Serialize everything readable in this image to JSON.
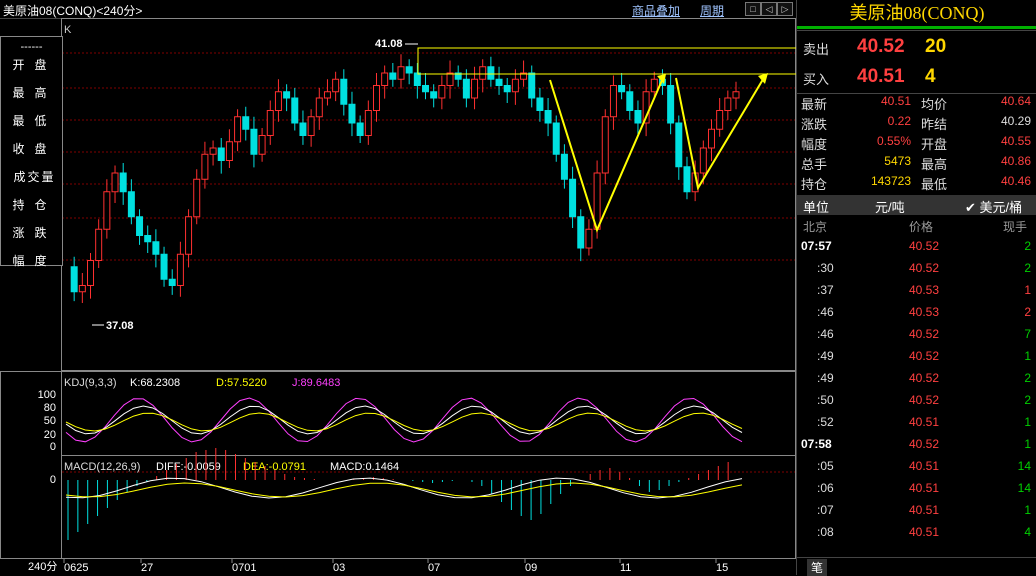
{
  "topbar": {
    "title": "美原油08(CONQ)<240分>",
    "overlay_link": "商品叠加",
    "period_link": "周期",
    "buttons": [
      "□",
      "◁",
      "▷",
      "✕"
    ]
  },
  "left_labels": [
    "开盘",
    "最高",
    "最低",
    "收盘",
    "成交量",
    "持仓",
    "涨跌",
    "幅度"
  ],
  "left_dash": "------",
  "k_label": "K",
  "price_annotations": {
    "high": "41.08",
    "low": "37.08"
  },
  "kdj": {
    "label": "KDJ(9,3,3)",
    "k": "K:68.2308",
    "d": "D:57.5220",
    "j": "J:89.6483",
    "scale": [
      "100",
      "80",
      "50",
      "20",
      "0"
    ]
  },
  "macd": {
    "label": "MACD(12,26,9)",
    "diff": "DIFF:-0.0059",
    "dea": "DEA:-0.0791",
    "macd": "MACD:0.1464",
    "zero": "0"
  },
  "xaxis": {
    "period": "240分",
    "labels": [
      "0625",
      "27",
      "0701",
      "03",
      "07",
      "09",
      "11",
      "15"
    ]
  },
  "colors": {
    "up": "#ff3030",
    "down": "#00e0e0",
    "grid": "#800000",
    "yellow": "#ffff00",
    "bg": "#000000"
  },
  "quote": {
    "title": "美原油08(CONQ)",
    "sell_label": "卖出",
    "sell_price": "40.52",
    "sell_vol": "20",
    "buy_label": "买入",
    "buy_price": "40.51",
    "buy_vol": "4",
    "stats": [
      {
        "l1": "最新",
        "v1": "40.51",
        "l2": "均价",
        "v2": "40.64"
      },
      {
        "l1": "涨跌",
        "v1": "0.22",
        "l2": "昨结",
        "v2": "40.29"
      },
      {
        "l1": "幅度",
        "v1": "0.55%",
        "l2": "开盘",
        "v2": "40.55"
      },
      {
        "l1": "总手",
        "v1": "5473",
        "l2": "最高",
        "v2": "40.86"
      },
      {
        "l1": "持仓",
        "v1": "143723",
        "l2": "最低",
        "v2": "40.46"
      }
    ],
    "unit_label": "单位",
    "unit_value": "元/吨",
    "unit_check": "✔ 美元/桶",
    "tick_header": {
      "time": "北京",
      "price": "价格",
      "vol": "现手"
    },
    "ticks": [
      {
        "t": "07:57",
        "p": "40.52",
        "v": "2",
        "bold": true
      },
      {
        "t": ":30",
        "p": "40.52",
        "v": "2"
      },
      {
        "t": ":37",
        "p": "40.53",
        "v": "1"
      },
      {
        "t": ":46",
        "p": "40.53",
        "v": "2"
      },
      {
        "t": ":46",
        "p": "40.52",
        "v": "7"
      },
      {
        "t": ":49",
        "p": "40.52",
        "v": "1"
      },
      {
        "t": ":49",
        "p": "40.52",
        "v": "2"
      },
      {
        "t": ":50",
        "p": "40.52",
        "v": "2"
      },
      {
        "t": ":52",
        "p": "40.51",
        "v": "1"
      },
      {
        "t": "07:58",
        "p": "40.52",
        "v": "1",
        "bold": true
      },
      {
        "t": ":05",
        "p": "40.51",
        "v": "14"
      },
      {
        "t": ":06",
        "p": "40.51",
        "v": "14"
      },
      {
        "t": ":07",
        "p": "40.51",
        "v": "1"
      },
      {
        "t": ":08",
        "p": "40.51",
        "v": "4"
      }
    ],
    "footer": "笔"
  }
}
